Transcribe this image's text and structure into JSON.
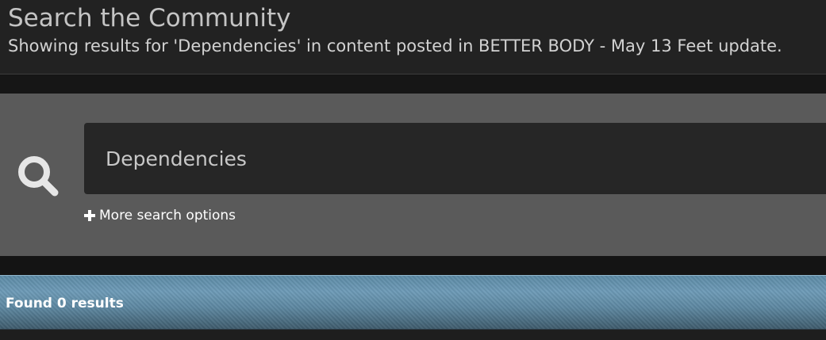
{
  "header": {
    "title": "Search the Community",
    "subtitle": "Showing results for 'Dependencies' in content posted in BETTER BODY - May 13 Feet update."
  },
  "search": {
    "value": "Dependencies",
    "icon": "search-icon",
    "more_options_label": "More search options",
    "more_options_icon": "plus-icon"
  },
  "results": {
    "summary": "Found 0 results"
  },
  "colors": {
    "header_bg": "#222222",
    "panel_bg": "#5a5a5a",
    "input_bg": "#262626",
    "results_bar": "#6d9ab6"
  }
}
